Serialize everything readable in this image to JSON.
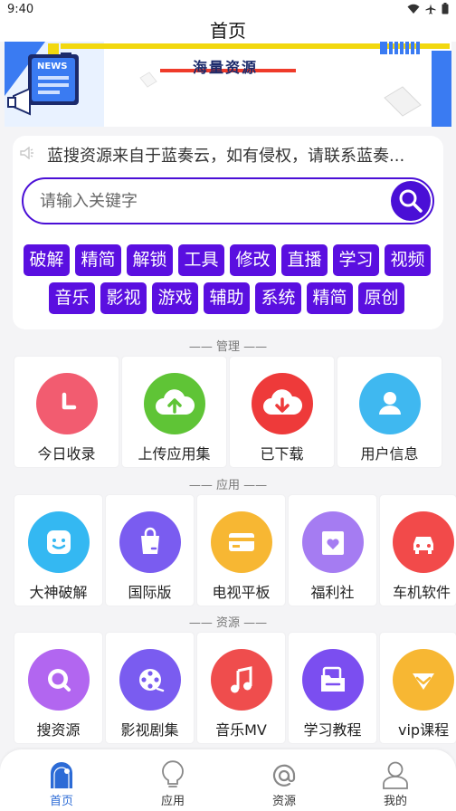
{
  "status_bar": {
    "time": "9:40"
  },
  "header": {
    "title": "首页"
  },
  "banner": {
    "badge": "NEWS",
    "headline": "海量资源"
  },
  "notice": {
    "text": "蓝搜资源来自于蓝奏云，如有侵权，请联系蓝奏..."
  },
  "search": {
    "placeholder": "请输入关键字"
  },
  "tags": {
    "row1": [
      "破解",
      "精简",
      "解锁",
      "工具",
      "修改",
      "直播",
      "学习",
      "视频"
    ],
    "row2": [
      "音乐",
      "影视",
      "游戏",
      "辅助",
      "系统",
      "精简",
      "原创"
    ]
  },
  "sections": {
    "management": "—— 管理 ——",
    "apps": "—— 应用 ——",
    "resources": "—— 资源 ——"
  },
  "management": {
    "items": [
      {
        "label": "今日收录",
        "icon": "clock-icon",
        "color": "#f25c70"
      },
      {
        "label": "上传应用集",
        "icon": "upload-cloud-icon",
        "color": "#5fc436"
      },
      {
        "label": "已下载",
        "icon": "download-cloud-icon",
        "color": "#ee3a3a"
      },
      {
        "label": "用户信息",
        "icon": "user-icon",
        "color": "#3fb8f0"
      }
    ]
  },
  "apps": {
    "items": [
      {
        "label": "大神破解",
        "icon": "smile-icon",
        "color": "#34b8f2"
      },
      {
        "label": "国际版",
        "icon": "bag-icon",
        "color": "#7a5cf0"
      },
      {
        "label": "电视平板",
        "icon": "card-icon",
        "color": "#f7b733"
      },
      {
        "label": "福利社",
        "icon": "gift-heart-icon",
        "color": "#a57cf2"
      },
      {
        "label": "车机软件",
        "icon": "car-icon",
        "color": "#f24a4a"
      }
    ]
  },
  "resources": {
    "items": [
      {
        "label": "搜资源",
        "icon": "search-icon",
        "color": "#b266f0"
      },
      {
        "label": "影视剧集",
        "icon": "film-reel-icon",
        "color": "#7a5cf0"
      },
      {
        "label": "音乐MV",
        "icon": "music-icon",
        "color": "#ef4d4d"
      },
      {
        "label": "学习教程",
        "icon": "folder-icon",
        "color": "#7b4ef0"
      },
      {
        "label": "vip课程",
        "icon": "diamond-icon",
        "color": "#f7b733"
      }
    ]
  },
  "bottom_nav": {
    "items": [
      {
        "label": "首页",
        "icon": "home-icon",
        "active": true
      },
      {
        "label": "应用",
        "icon": "bulb-icon",
        "active": false
      },
      {
        "label": "资源",
        "icon": "at-icon",
        "active": false
      },
      {
        "label": "我的",
        "icon": "profile-icon",
        "active": false
      }
    ]
  },
  "colors": {
    "accent": "#4a0fd6",
    "tag": "#5a0fe0",
    "nav_active": "#2c6bd6"
  }
}
